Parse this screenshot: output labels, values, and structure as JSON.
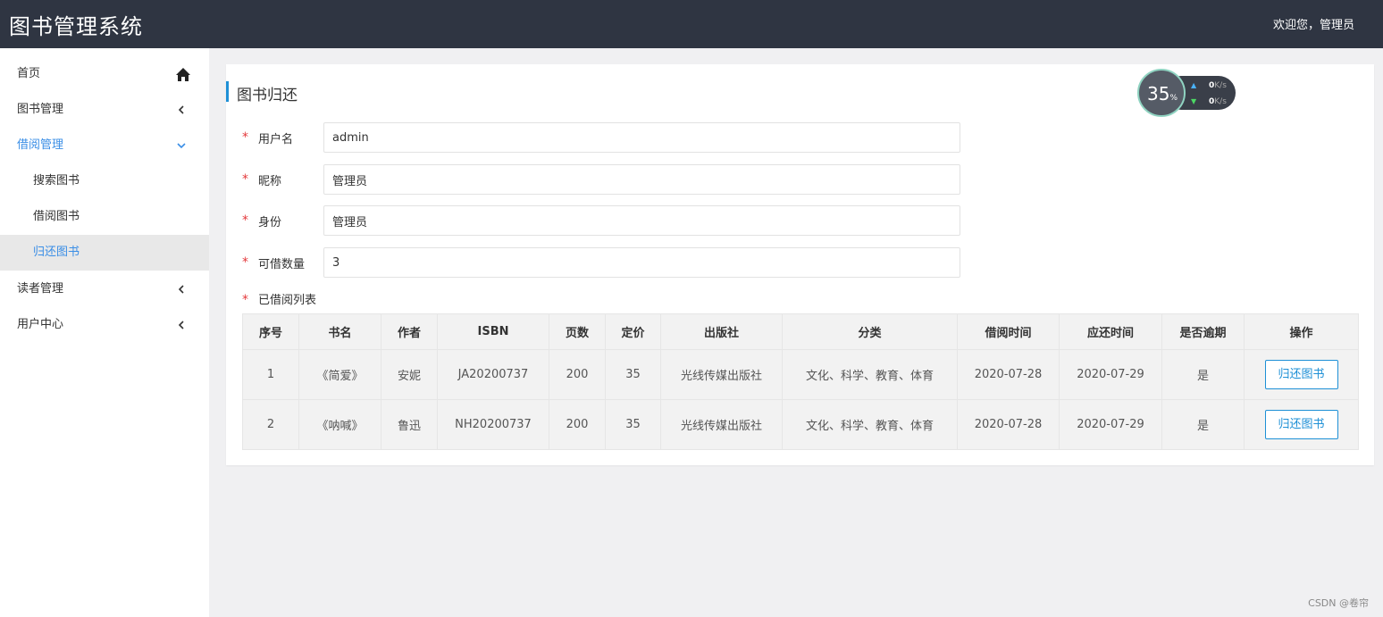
{
  "header": {
    "app_title": "图书管理系统",
    "welcome": "欢迎您，管理员"
  },
  "sidebar": {
    "items": [
      {
        "label": "首页",
        "icon": "home-icon"
      },
      {
        "label": "图书管理",
        "icon": "chevron-left-icon"
      },
      {
        "label": "借阅管理",
        "icon": "chevron-down-icon",
        "expanded": true
      },
      {
        "label": "读者管理",
        "icon": "chevron-left-icon"
      },
      {
        "label": "用户中心",
        "icon": "chevron-left-icon"
      }
    ],
    "sub_items": [
      {
        "label": "搜索图书"
      },
      {
        "label": "借阅图书"
      },
      {
        "label": "归还图书",
        "selected": true
      }
    ]
  },
  "panel": {
    "title": "图书归还",
    "fields": [
      {
        "label": "用户名",
        "value": "admin"
      },
      {
        "label": "昵称",
        "value": "管理员"
      },
      {
        "label": "身份",
        "value": "管理员"
      },
      {
        "label": "可借数量",
        "value": "3"
      }
    ],
    "required_mark": "*",
    "list_label": "已借阅列表",
    "table": {
      "headers": [
        "序号",
        "书名",
        "作者",
        "ISBN",
        "页数",
        "定价",
        "出版社",
        "分类",
        "借阅时间",
        "应还时间",
        "是否逾期",
        "操作"
      ],
      "rows": [
        [
          "1",
          "《简爱》",
          "安妮",
          "JA20200737",
          "200",
          "35",
          "光线传媒出版社",
          "文化、科学、教育、体育",
          "2020-07-28",
          "2020-07-29",
          "是"
        ],
        [
          "2",
          "《呐喊》",
          "鲁迅",
          "NH20200737",
          "200",
          "35",
          "光线传媒出版社",
          "文化、科学、教育、体育",
          "2020-07-28",
          "2020-07-29",
          "是"
        ]
      ],
      "action_label": "归还图书"
    }
  },
  "speed_widget": {
    "percent": "35",
    "percent_unit": "%",
    "up_speed": "0",
    "down_speed": "0",
    "unit": "K/s"
  },
  "watermark": "CSDN @卷帘",
  "colors": {
    "topbar": "#2f3542",
    "accent": "#1e90d6",
    "active_nav": "#3a8ee6",
    "required": "#e4393c"
  }
}
